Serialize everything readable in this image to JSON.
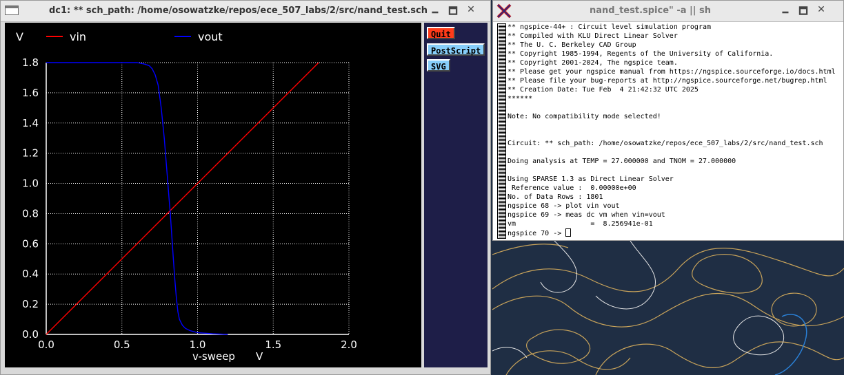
{
  "plot_window": {
    "title": "dc1: ** sch_path: /home/osowatzke/repos/ece_507_labs/2/src/nand_test.sch",
    "controls": {
      "minimize": "🗕",
      "maximize": "🗖",
      "close": "✕"
    },
    "buttons": {
      "quit": "Quit",
      "postscript": "PostScript",
      "svg": "SVG"
    }
  },
  "terminal_window": {
    "title": "nand_test.spice\" -a || sh",
    "controls": {
      "minimize": "🗕",
      "maximize": "🗖",
      "close": "✕"
    },
    "lines": [
      "** ngspice-44+ : Circuit level simulation program",
      "** Compiled with KLU Direct Linear Solver",
      "** The U. C. Berkeley CAD Group",
      "** Copyright 1985-1994, Regents of the University of California.",
      "** Copyright 2001-2024, The ngspice team.",
      "** Please get your ngspice manual from https://ngspice.sourceforge.io/docs.html",
      "** Please file your bug-reports at http://ngspice.sourceforge.net/bugrep.html",
      "** Creation Date: Tue Feb  4 21:42:32 UTC 2025",
      "******",
      "",
      "Note: No compatibility mode selected!",
      "",
      "",
      "Circuit: ** sch_path: /home/osowatzke/repos/ece_507_labs/2/src/nand_test.sch",
      "",
      "Doing analysis at TEMP = 27.000000 and TNOM = 27.000000",
      "",
      "Using SPARSE 1.3 as Direct Linear Solver",
      " Reference value :  0.00000e+00",
      "No. of Data Rows : 1801",
      "ngspice 68 -> plot vin vout",
      "ngspice 69 -> meas dc vm when vin=vout",
      "vm                  =  8.256941e-01"
    ],
    "prompt": "ngspice 70 -> "
  },
  "chart_data": {
    "type": "line",
    "ylabel": "V",
    "xlabel": "v-sweep",
    "xunit": "V",
    "xlim": [
      0.0,
      2.0
    ],
    "ylim": [
      0.0,
      1.8
    ],
    "xticks": [
      "0.0",
      "0.5",
      "1.0",
      "1.5",
      "2.0"
    ],
    "yticks": [
      "0.0",
      "0.2",
      "0.4",
      "0.6",
      "0.8",
      "1.0",
      "1.2",
      "1.4",
      "1.6",
      "1.8"
    ],
    "grid": true,
    "background": "#000000",
    "axis_color": "#ffffff",
    "series": [
      {
        "name": "vin",
        "color": "#ff0000",
        "x": [
          0.0,
          1.8
        ],
        "y": [
          0.0,
          1.8
        ]
      },
      {
        "name": "vout",
        "color": "#0000ff",
        "x": [
          0.0,
          0.5,
          0.6,
          0.65,
          0.68,
          0.7,
          0.72,
          0.74,
          0.76,
          0.78,
          0.8,
          0.81,
          0.82,
          0.83,
          0.84,
          0.85,
          0.86,
          0.87,
          0.88,
          0.9,
          0.92,
          0.95,
          1.0,
          1.1,
          1.2
        ],
        "y": [
          1.8,
          1.8,
          1.8,
          1.79,
          1.78,
          1.76,
          1.72,
          1.65,
          1.5,
          1.3,
          1.05,
          0.92,
          0.8,
          0.65,
          0.5,
          0.36,
          0.24,
          0.15,
          0.1,
          0.06,
          0.04,
          0.025,
          0.012,
          0.004,
          0.0
        ]
      }
    ]
  }
}
